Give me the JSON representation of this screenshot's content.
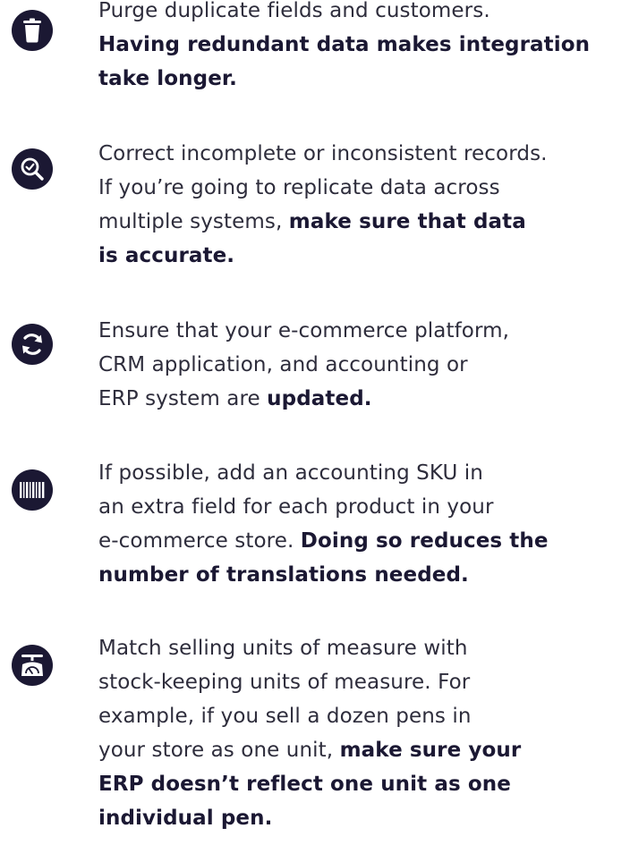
{
  "colors": {
    "icon_bg": "#1b1833",
    "text": "#2e2d3c",
    "bold_text": "#1b1833"
  },
  "items": [
    {
      "icon": "trash-icon",
      "lines": [
        [
          {
            "t": "Purge duplicate fields and customers.",
            "b": false
          }
        ],
        [
          {
            "t": "Having redundant data makes integration",
            "b": true
          }
        ],
        [
          {
            "t": "take longer.",
            "b": true
          }
        ]
      ]
    },
    {
      "icon": "magnifier-check-icon",
      "lines": [
        [
          {
            "t": "Correct incomplete or inconsistent records.",
            "b": false
          }
        ],
        [
          {
            "t": "If you’re going to replicate data across",
            "b": false
          }
        ],
        [
          {
            "t": "multiple systems, ",
            "b": false
          },
          {
            "t": "make sure that data",
            "b": true
          }
        ],
        [
          {
            "t": "is accurate.",
            "b": true
          }
        ]
      ]
    },
    {
      "icon": "sync-icon",
      "lines": [
        [
          {
            "t": "Ensure that your e-commerce platform,",
            "b": false
          }
        ],
        [
          {
            "t": "CRM application, and accounting or",
            "b": false
          }
        ],
        [
          {
            "t": "ERP system are ",
            "b": false
          },
          {
            "t": "updated.",
            "b": true
          }
        ]
      ]
    },
    {
      "icon": "barcode-icon",
      "lines": [
        [
          {
            "t": "If possible, add an accounting SKU in",
            "b": false
          }
        ],
        [
          {
            "t": "an extra field for each product in your",
            "b": false
          }
        ],
        [
          {
            "t": "e-commerce store. ",
            "b": false
          },
          {
            "t": "Doing so reduces the",
            "b": true
          }
        ],
        [
          {
            "t": "number of translations needed.",
            "b": true
          }
        ]
      ]
    },
    {
      "icon": "scale-icon",
      "lines": [
        [
          {
            "t": "Match selling units of measure with",
            "b": false
          }
        ],
        [
          {
            "t": "stock-keeping units of measure. For",
            "b": false
          }
        ],
        [
          {
            "t": "example, if you sell a dozen pens in",
            "b": false
          }
        ],
        [
          {
            "t": "your store as one unit, ",
            "b": false
          },
          {
            "t": "make sure your",
            "b": true
          }
        ],
        [
          {
            "t": "ERP doesn’t reflect one unit as one",
            "b": true
          }
        ],
        [
          {
            "t": "individual pen.",
            "b": true
          }
        ]
      ]
    }
  ]
}
